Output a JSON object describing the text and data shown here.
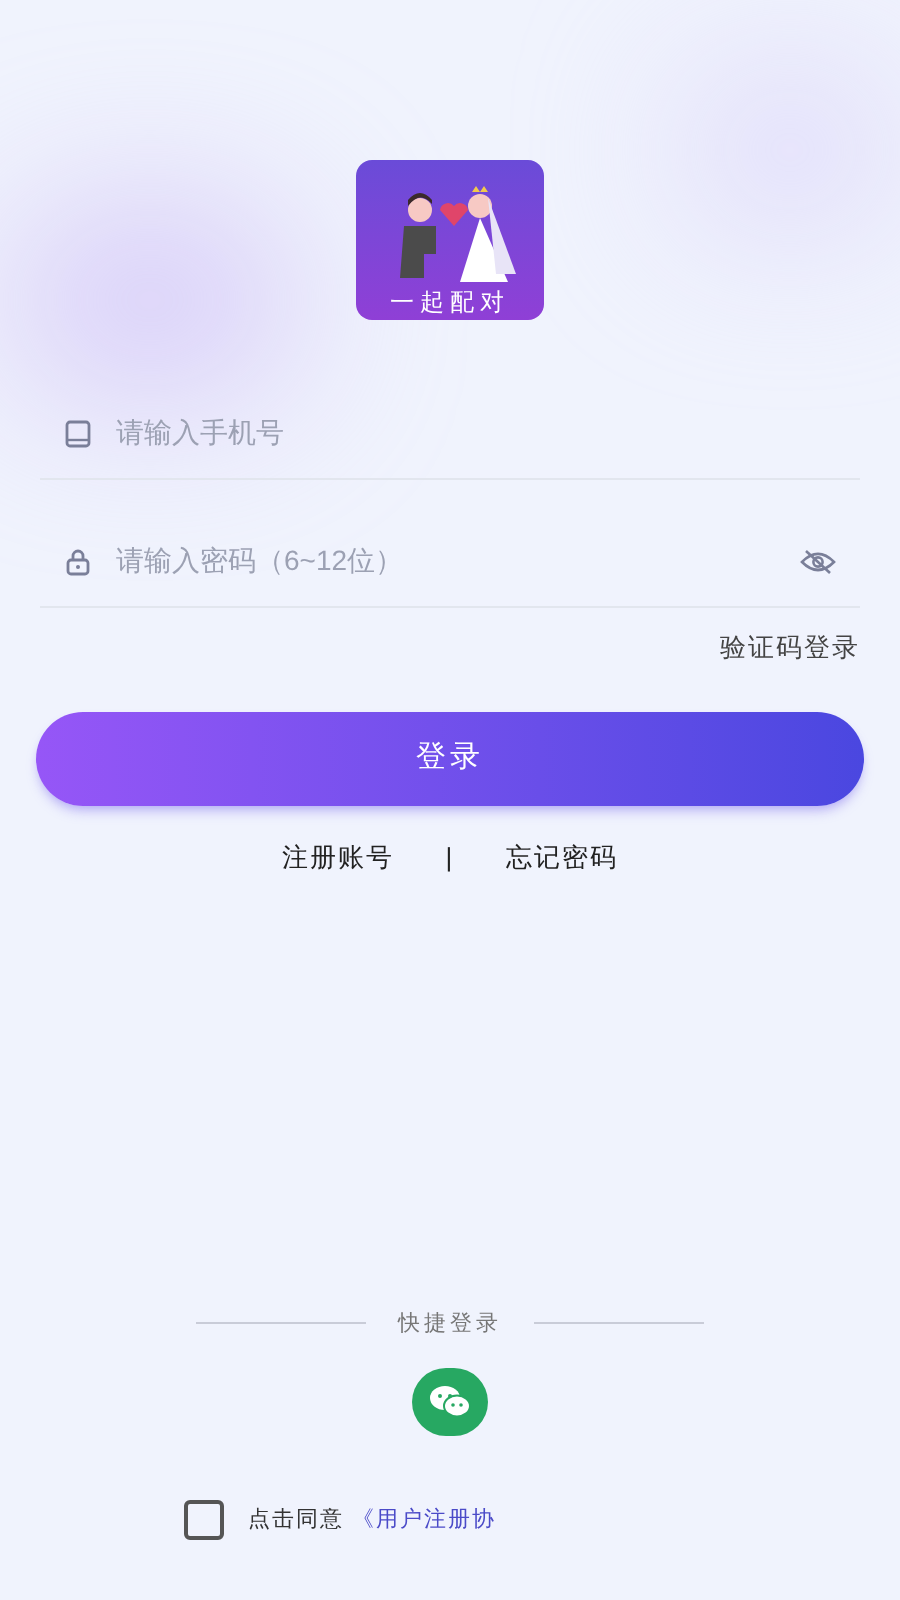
{
  "logo": {
    "caption": "一起配对"
  },
  "phone_field": {
    "placeholder": "请输入手机号"
  },
  "password_field": {
    "placeholder": "请输入密码（6~12位）",
    "visible": false
  },
  "code_login_link": "验证码登录",
  "login_button": "登录",
  "links": [
    "注册账号",
    "|",
    "忘记密码"
  ],
  "quick_login": {
    "label": "快捷登录"
  },
  "agreement": {
    "checked": false,
    "text": "点击同意",
    "link": "《用户注册协"
  }
}
